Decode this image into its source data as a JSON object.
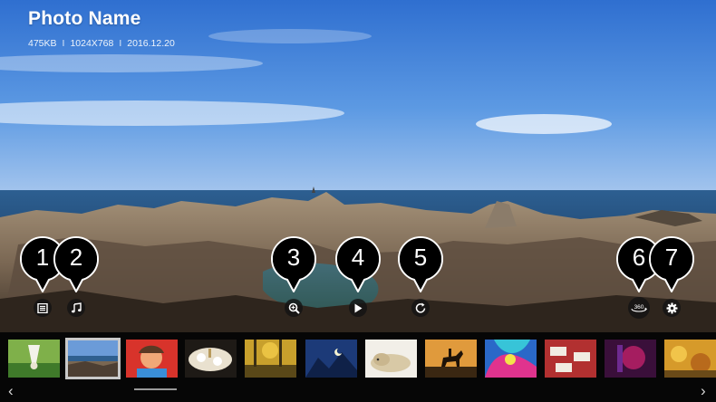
{
  "photo": {
    "name": "Photo Name",
    "size": "475KB",
    "resolution": "1024X768",
    "date": "2016.12.20",
    "separator": "I"
  },
  "controls": [
    {
      "id": "list",
      "icon": "list-icon"
    },
    {
      "id": "music",
      "icon": "music-note-icon"
    },
    {
      "id": "zoom",
      "icon": "zoom-in-icon"
    },
    {
      "id": "slideshow",
      "icon": "play-icon"
    },
    {
      "id": "rotate",
      "icon": "rotate-icon"
    },
    {
      "id": "view360",
      "icon": "360-view-icon",
      "label": "360"
    },
    {
      "id": "settings",
      "icon": "gear-icon"
    }
  ],
  "callouts": [
    "1",
    "2",
    "3",
    "4",
    "5",
    "6",
    "7"
  ],
  "thumbnails": [
    {
      "name": "badminton-shuttlecock",
      "selected": false
    },
    {
      "name": "coastal-landscape",
      "selected": true
    },
    {
      "name": "child-portrait",
      "selected": false
    },
    {
      "name": "dining-table",
      "selected": false
    },
    {
      "name": "autumn-forest",
      "selected": false
    },
    {
      "name": "mountains-night-moon",
      "selected": false
    },
    {
      "name": "sleeping-dog",
      "selected": false
    },
    {
      "name": "horse-rider-sunset",
      "selected": false
    },
    {
      "name": "colorful-art",
      "selected": false
    },
    {
      "name": "restaurant-tables",
      "selected": false
    },
    {
      "name": "purple-pink-abstract",
      "selected": false
    },
    {
      "name": "autumn-leaves",
      "selected": false
    }
  ],
  "navigation": {
    "prev": "‹",
    "next": "›"
  }
}
